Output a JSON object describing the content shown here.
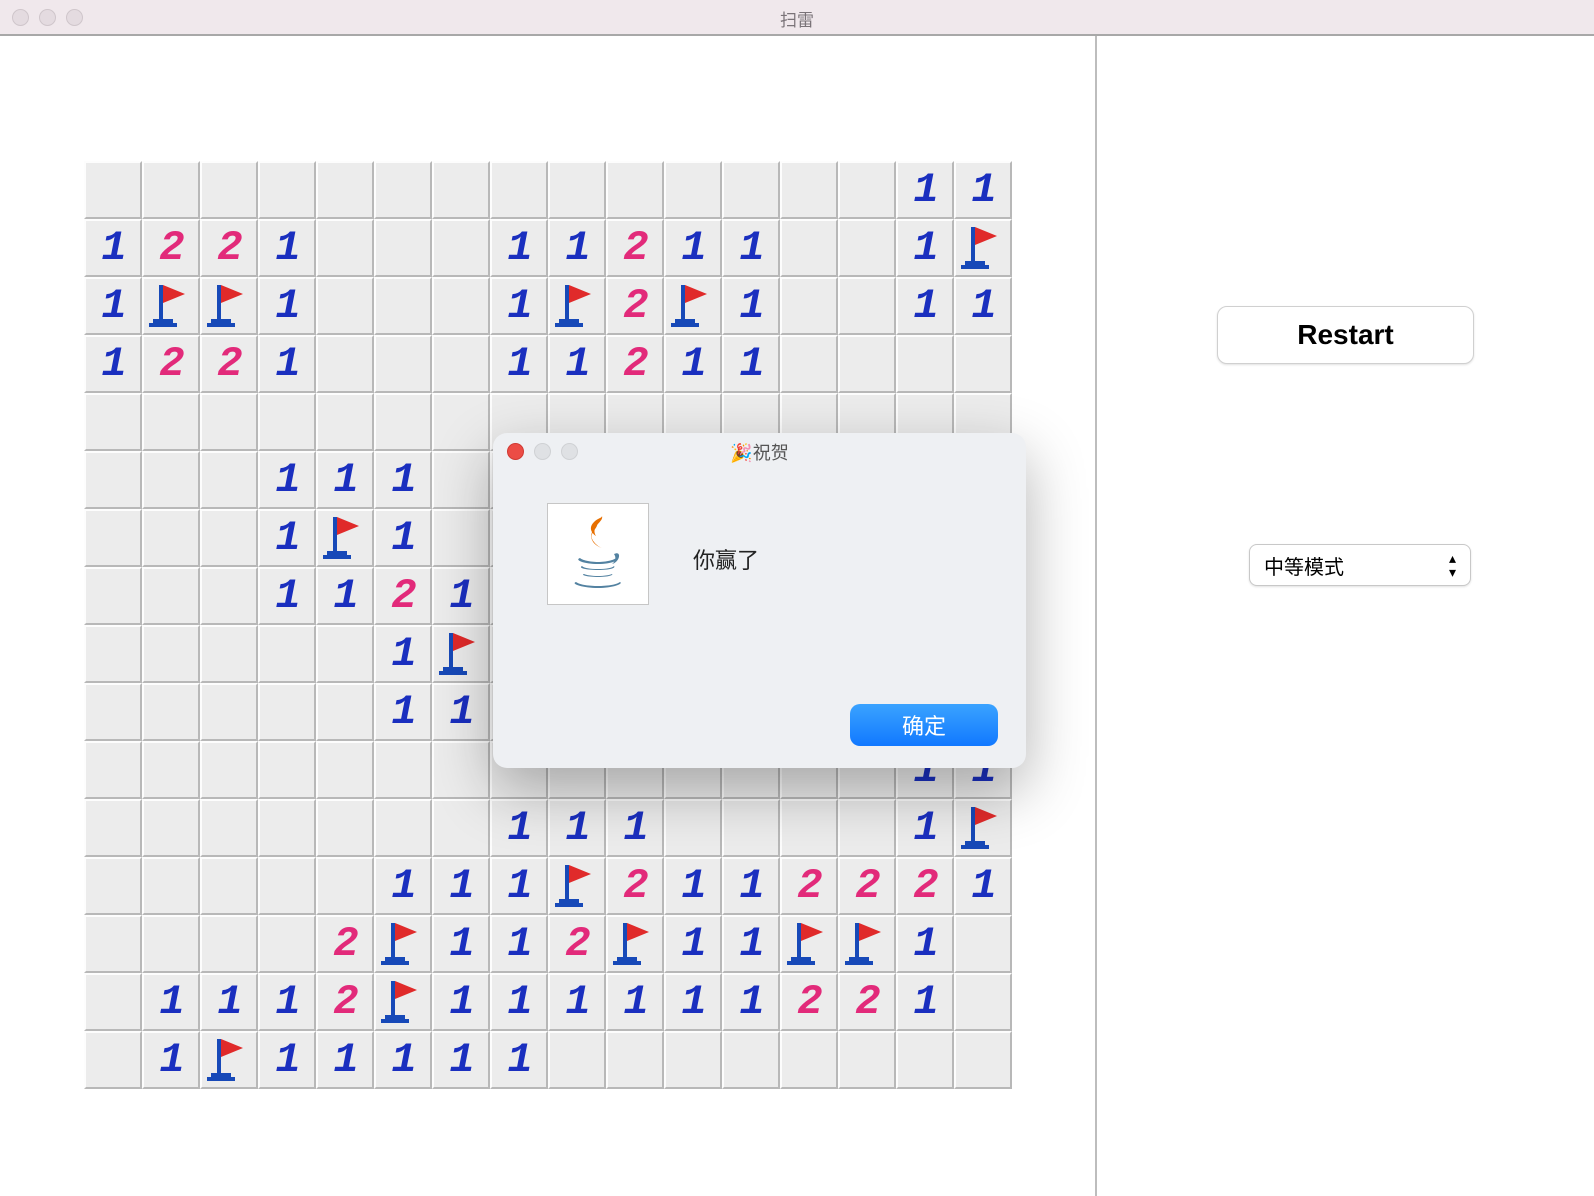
{
  "window": {
    "title": "扫雷"
  },
  "sidebar": {
    "restart_label": "Restart",
    "difficulty_selected": "中等模式"
  },
  "dialog": {
    "title": "🎉祝贺",
    "message": "你赢了",
    "ok_label": "确定"
  },
  "board": {
    "cols": 16,
    "rows": 16,
    "legend": {
      "0": "blank-revealed",
      "1..8": "number",
      "F": "flag"
    },
    "grid": [
      [
        0,
        0,
        0,
        0,
        0,
        0,
        0,
        0,
        0,
        0,
        0,
        0,
        0,
        0,
        1,
        1
      ],
      [
        1,
        2,
        2,
        1,
        0,
        0,
        0,
        1,
        1,
        2,
        1,
        1,
        0,
        0,
        1,
        "F"
      ],
      [
        1,
        "F",
        "F",
        1,
        0,
        0,
        0,
        1,
        "F",
        2,
        "F",
        1,
        0,
        0,
        1,
        1
      ],
      [
        1,
        2,
        2,
        1,
        0,
        0,
        0,
        1,
        1,
        2,
        1,
        1,
        0,
        0,
        0,
        0
      ],
      [
        0,
        0,
        0,
        0,
        0,
        0,
        0,
        0,
        0,
        0,
        0,
        0,
        0,
        0,
        0,
        0
      ],
      [
        0,
        0,
        0,
        1,
        1,
        1,
        0,
        0,
        0,
        0,
        0,
        0,
        0,
        0,
        0,
        0
      ],
      [
        0,
        0,
        0,
        1,
        "F",
        1,
        0,
        0,
        0,
        0,
        0,
        0,
        0,
        0,
        0,
        0
      ],
      [
        0,
        0,
        0,
        1,
        1,
        2,
        1,
        0,
        0,
        0,
        0,
        0,
        0,
        0,
        0,
        0
      ],
      [
        0,
        0,
        0,
        0,
        0,
        1,
        "F",
        0,
        0,
        0,
        0,
        0,
        0,
        0,
        0,
        0
      ],
      [
        0,
        0,
        0,
        0,
        0,
        1,
        1,
        0,
        0,
        0,
        0,
        0,
        0,
        0,
        0,
        0
      ],
      [
        0,
        0,
        0,
        0,
        0,
        0,
        0,
        0,
        0,
        0,
        0,
        0,
        0,
        0,
        1,
        1
      ],
      [
        0,
        0,
        0,
        0,
        0,
        0,
        0,
        1,
        1,
        1,
        0,
        0,
        0,
        0,
        1,
        "F"
      ],
      [
        0,
        0,
        0,
        0,
        0,
        1,
        1,
        1,
        "F",
        2,
        1,
        1,
        2,
        2,
        2,
        1
      ],
      [
        0,
        0,
        0,
        0,
        2,
        "F",
        1,
        1,
        2,
        "F",
        1,
        1,
        "F",
        "F",
        1,
        0
      ],
      [
        0,
        1,
        1,
        1,
        2,
        "F",
        1,
        1,
        1,
        1,
        1,
        1,
        2,
        2,
        1,
        0
      ],
      [
        0,
        1,
        "F",
        1,
        1,
        1,
        1,
        1,
        0,
        0,
        0,
        0,
        0,
        0,
        0,
        0
      ]
    ]
  }
}
